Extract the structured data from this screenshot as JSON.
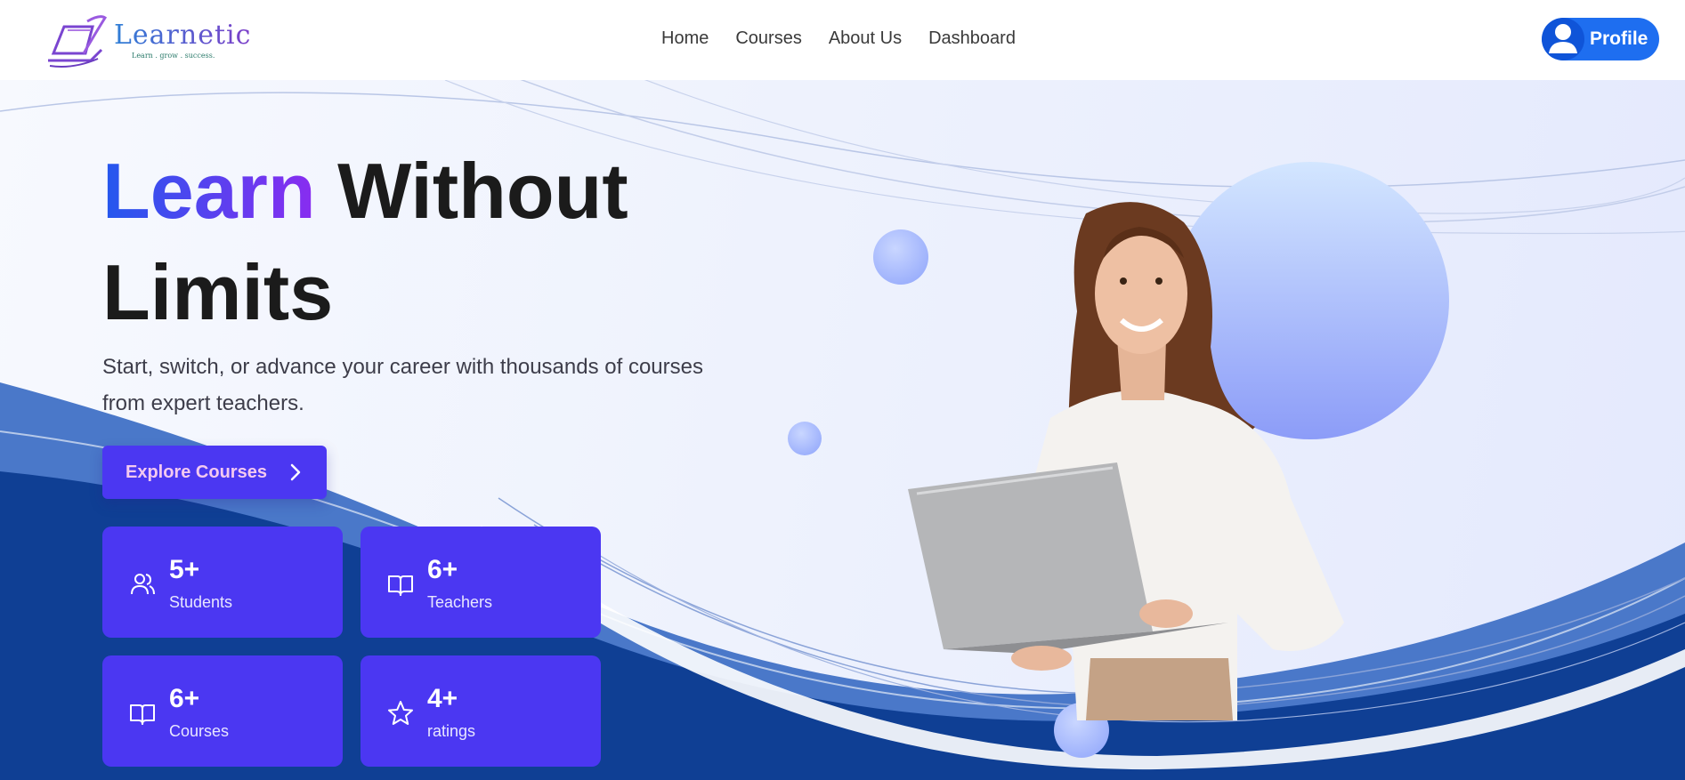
{
  "brand": {
    "name": "Learnetic",
    "tagline": "Learn . grow . success."
  },
  "nav": {
    "items": [
      {
        "label": "Home"
      },
      {
        "label": "Courses"
      },
      {
        "label": "About Us"
      },
      {
        "label": "Dashboard"
      }
    ]
  },
  "profile": {
    "label": "Profile",
    "icon": "user-icon",
    "color": "#1e6ef0"
  },
  "hero": {
    "title_highlight": "Learn",
    "title_rest": " Without Limits",
    "subtitle": "Start, switch, or advance your career with thousands of courses from expert teachers.",
    "cta_label": "Explore Courses",
    "cta_icon": "chevron-right-icon"
  },
  "stats": [
    {
      "value": "5+",
      "label": "Students",
      "icon": "users-icon"
    },
    {
      "value": "6+",
      "label": "Teachers",
      "icon": "book-open-icon"
    },
    {
      "value": "6+",
      "label": "Courses",
      "icon": "book-open-icon"
    },
    {
      "value": "4+",
      "label": "ratings",
      "icon": "star-icon"
    }
  ],
  "colors": {
    "accent": "#4b37f2",
    "title_gradient_start": "#2358ee",
    "title_gradient_end": "#8a2cf0",
    "wave_dark": "#0f3f94",
    "wave_mid": "#3a6cc4"
  }
}
